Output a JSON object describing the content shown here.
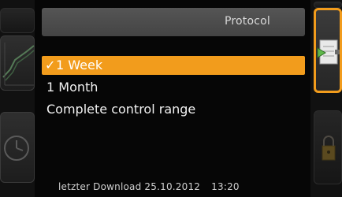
{
  "header": {
    "title": "Protocol"
  },
  "menu": {
    "items": [
      {
        "label": "1 Week",
        "selected": true,
        "check": "✓"
      },
      {
        "label": "1 Month",
        "selected": false
      },
      {
        "label": "Complete control range",
        "selected": false
      }
    ]
  },
  "footer": {
    "label": "letzter Download",
    "date": "25.10.2012",
    "time": "13:20"
  },
  "colors": {
    "accent": "#f29c1c",
    "background": "#060606",
    "header": "#4b4b4b"
  },
  "icons": {
    "left_top": "chart-icon",
    "left_bottom": "clock-icon",
    "right_top": "download-protocol-icon",
    "right_bottom": "lock-icon"
  }
}
